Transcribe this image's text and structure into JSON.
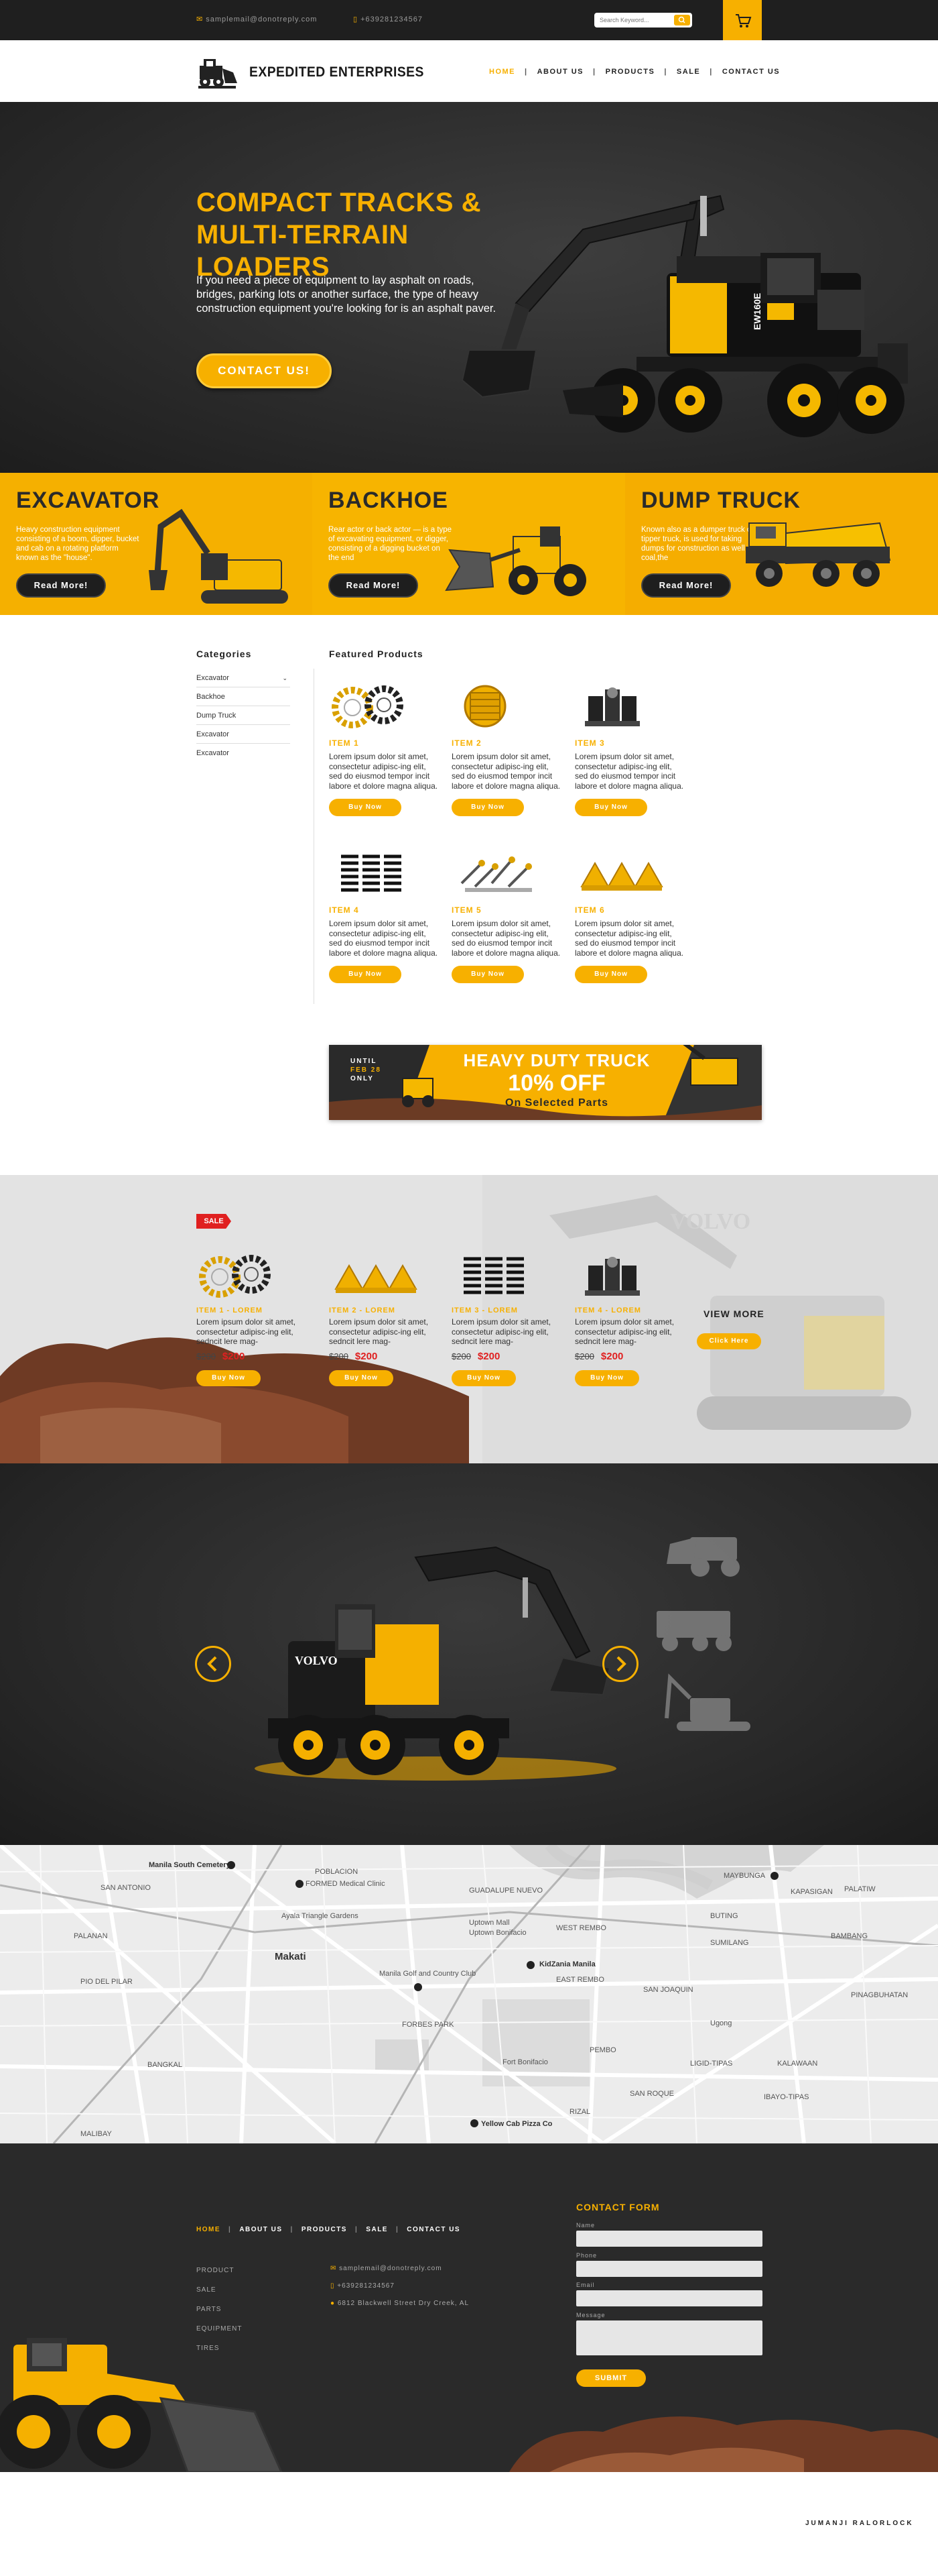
{
  "topbar": {
    "email": "samplemail@donotreply.com",
    "phone": "+639281234567",
    "search_placeholder": "Search Keyword..."
  },
  "header": {
    "brand": "EXPEDITED ENTERPRISES",
    "nav": [
      "HOME",
      "ABOUT US",
      "PRODUCTS",
      "SALE",
      "CONTACT US"
    ]
  },
  "hero": {
    "title_line1": "COMPACT TRACKS &",
    "title_line2": "MULTI-TERRAIN LOADERS",
    "text": "If you need a piece of equipment to lay asphalt on roads, bridges, parking lots or another surface, the type of heavy construction equipment you're looking for is an asphalt paver.",
    "button": "CONTACT US!",
    "machine_brand": "EW160E"
  },
  "categories_strip": [
    {
      "title": "EXCAVATOR",
      "text": "Heavy construction equipment consisting of a boom, dipper, bucket and cab on a rotating platform known as the \"house\".",
      "button": "Read More!"
    },
    {
      "title": "BACKHOE",
      "text": "Rear actor or back actor — is a type of excavating equipment, or digger, consisting of a digging bucket on the end",
      "button": "Read More!"
    },
    {
      "title": "DUMP TRUCK",
      "text": "Known also as a dumper truck or tipper truck, is used for taking dumps for construction as well as coal,the",
      "button": "Read More!"
    }
  ],
  "sidebar": {
    "title": "Categories",
    "items": [
      "Excavator",
      "Backhoe",
      "Dump Truck",
      "Excavator",
      "Excavator"
    ]
  },
  "featured": {
    "title": "Featured Products",
    "items": [
      {
        "name": "ITEM 1",
        "desc": "Lorem ipsum dolor sit amet, consectetur adipisc-ing elit, sed do eiusmod tempor incit labore et dolore magna aliqua.",
        "button": "Buy Now"
      },
      {
        "name": "ITEM 2",
        "desc": "Lorem ipsum dolor sit amet, consectetur adipisc-ing elit, sed do eiusmod tempor incit labore et dolore magna aliqua.",
        "button": "Buy Now"
      },
      {
        "name": "ITEM 3",
        "desc": "Lorem ipsum dolor sit amet, consectetur adipisc-ing elit, sed do eiusmod tempor incit labore et dolore magna aliqua.",
        "button": "Buy Now"
      },
      {
        "name": "ITEM 4",
        "desc": "Lorem ipsum dolor sit amet, consectetur adipisc-ing elit, sed do eiusmod tempor incit labore et dolore magna aliqua.",
        "button": "Buy Now"
      },
      {
        "name": "ITEM 5",
        "desc": "Lorem ipsum dolor sit amet, consectetur adipisc-ing elit, sed do eiusmod tempor incit labore et dolore magna aliqua.",
        "button": "Buy Now"
      },
      {
        "name": "ITEM 6",
        "desc": "Lorem ipsum dolor sit amet, consectetur adipisc-ing elit, sed do eiusmod tempor incit labore et dolore magna aliqua.",
        "button": "Buy Now"
      }
    ]
  },
  "promo": {
    "until": "UNTIL",
    "date": "FEB 28",
    "only": "ONLY",
    "headline": "HEAVY DUTY TRUCK",
    "discount": "10% OFF",
    "sub": "On Selected Parts"
  },
  "sale": {
    "badge": "SALE",
    "items": [
      {
        "name": "ITEM 1 - LOREM",
        "desc": "Lorem ipsum dolor sit amet, consectetur adipisc-ing elit, sedncit lere mag-",
        "old_price": "$200",
        "new_price": "$200",
        "button": "Buy Now"
      },
      {
        "name": "ITEM 2 - LOREM",
        "desc": "Lorem ipsum dolor sit amet, consectetur adipisc-ing elit, sedncit lere mag-",
        "old_price": "$200",
        "new_price": "$200",
        "button": "Buy Now"
      },
      {
        "name": "ITEM 3 - LOREM",
        "desc": "Lorem ipsum dolor sit amet, consectetur adipisc-ing elit, sedncit lere mag-",
        "old_price": "$200",
        "new_price": "$200",
        "button": "Buy Now"
      },
      {
        "name": "ITEM 4 - LOREM",
        "desc": "Lorem ipsum dolor sit amet, consectetur adipisc-ing elit, sedncit lere mag-",
        "old_price": "$200",
        "new_price": "$200",
        "button": "Buy Now"
      }
    ],
    "view_more": "VIEW MORE",
    "view_button": "Click Here"
  },
  "showcase": {
    "machine_brand": "VOLVO"
  },
  "map": {
    "labels": [
      "Manila South Cemetery",
      "FORMED Medical Clinic",
      "POBLACION",
      "SAN ANTONIO",
      "GUADALUPE NUEVO",
      "Ayala Triangle Gardens",
      "Uptown Mall",
      "Uptown Bonifacio",
      "WEST REMBO",
      "Makati",
      "EAST REMBO",
      "Manila Golf and Country Club",
      "KidZania Manila",
      "SAN JOAQUIN",
      "PIO DEL PILAR",
      "FORBES PARK",
      "BANGKAL",
      "Fort Bonifacio",
      "PEMBO",
      "LIGID-TIPAS",
      "KALAWAAN",
      "SAN ROQUE",
      "IBAYO-TIPAS",
      "Yellow Cab Pizza Co",
      "MALIBAY",
      "RIZAL",
      "PALANAN",
      "BUTING",
      "BAMBANG",
      "Ugong",
      "PINAGBUHATAN",
      "MAYBUNGA",
      "PALATIW",
      "KAPASIGAN",
      "SUMILANG"
    ]
  },
  "footer": {
    "nav": [
      "HOME",
      "ABOUT US",
      "PRODUCTS",
      "SALE",
      "CONTACT US"
    ],
    "links": [
      "PRODUCT",
      "SALE",
      "PARTS",
      "EQUIPMENT",
      "TIRES"
    ],
    "email": "samplemail@donotreply.com",
    "phone": "+639281234567",
    "address": "6812 Blackwell Street Dry Creek, AL",
    "contact_title": "CONTACT FORM",
    "fields": [
      "Name",
      "Phone",
      "Email",
      "Message"
    ],
    "submit": "SUBMIT",
    "credit": "JUMANJI RALORLOCK"
  },
  "colors": {
    "accent": "#f7b000",
    "dark": "#1f1f1f",
    "sale_red": "#e02020"
  }
}
